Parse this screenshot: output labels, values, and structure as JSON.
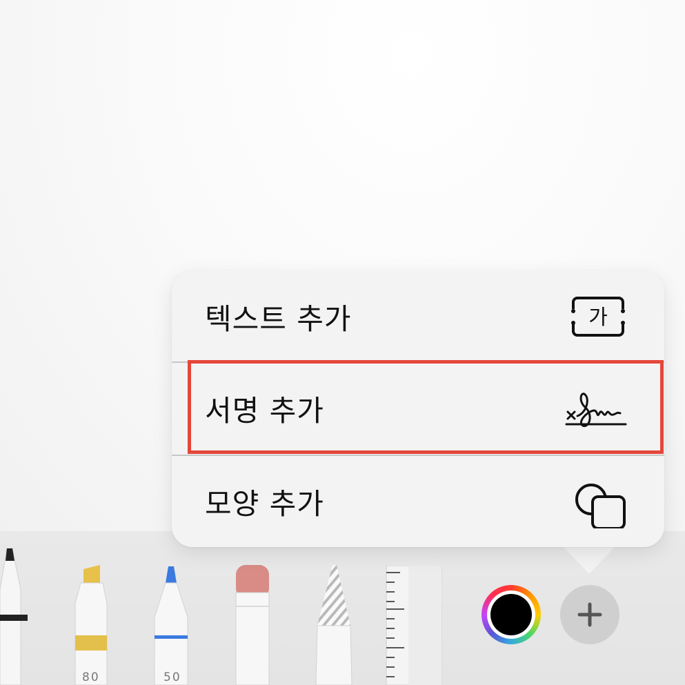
{
  "menu": {
    "items": [
      {
        "label": "텍스트 추가",
        "icon": "text-box-icon"
      },
      {
        "label": "서명 추가",
        "icon": "signature-icon"
      },
      {
        "label": "모양 추가",
        "icon": "shapes-icon"
      }
    ],
    "highlight_color": "#e5463a"
  },
  "icons": {
    "text_box_glyph": "가"
  },
  "toolbar": {
    "highlighter_size": "80",
    "pen_size": "50",
    "tools": [
      "pen",
      "highlighter",
      "pencil",
      "eraser",
      "lasso",
      "ruler"
    ],
    "current_color": "#000000",
    "add_button": "plus-icon"
  }
}
